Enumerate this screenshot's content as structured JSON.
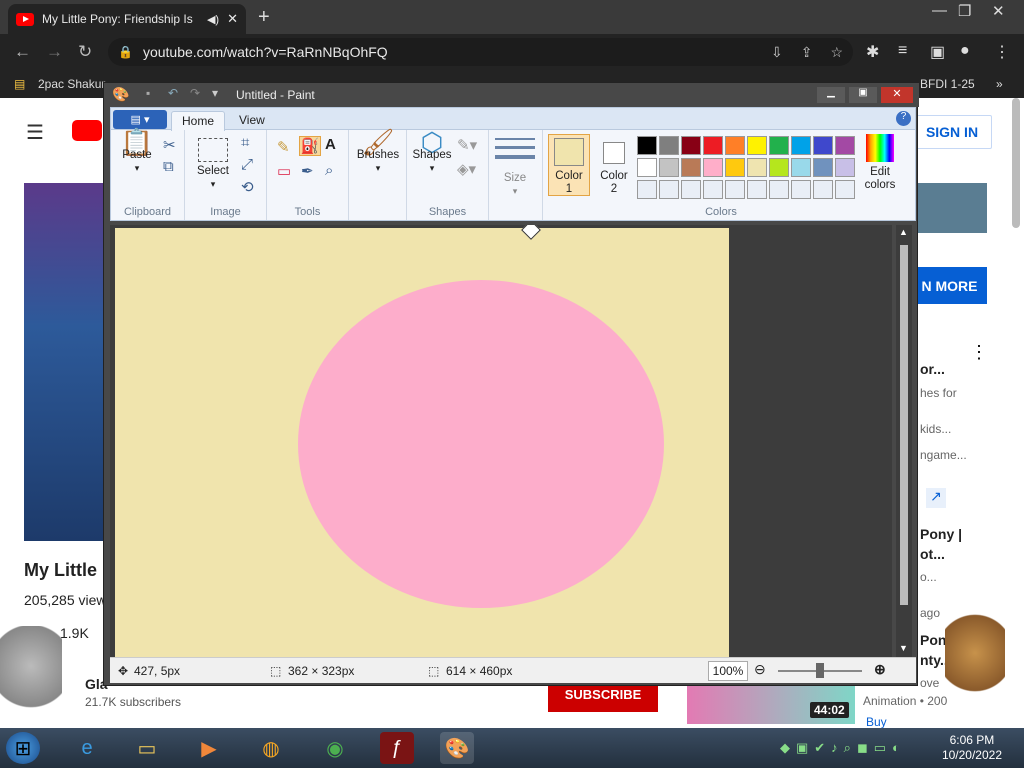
{
  "browser": {
    "tab_title": "My Little Pony: Friendship Is",
    "url": "youtube.com/watch?v=RaRnNBqOhFQ",
    "bookmarks": [
      "2pac Shakur",
      "BFDI 1-25"
    ]
  },
  "youtube": {
    "sign_in": "SIGN IN",
    "learn_more": "N MORE",
    "video_title": "My Little",
    "views": "205,285 view",
    "likes": "1.9K",
    "channel_initial": "Gla",
    "subscribers": "21.7K subscribers",
    "subscribe": "SUBSCRIBE",
    "duration": "44:02",
    "side_texts": [
      "or...",
      "hes for",
      "kids...",
      "ngame...",
      "Pony |",
      "ot...",
      "o...",
      "ago",
      "Pony",
      "nty..",
      "ove",
      "Animation • 200",
      "Buy"
    ]
  },
  "paint": {
    "title": "Untitled - Paint",
    "tabs": [
      "Home",
      "View"
    ],
    "groups": {
      "clipboard": {
        "label": "Clipboard",
        "paste": "Paste"
      },
      "image": {
        "label": "Image",
        "select": "Select"
      },
      "tools": {
        "label": "Tools"
      },
      "brushes": "Brushes",
      "shapes": {
        "label": "Shapes",
        "shapes_btn": "Shapes"
      },
      "size": "Size",
      "colors": {
        "label": "Colors",
        "color1": "Color 1",
        "color2": "Color 2",
        "edit": "Edit colors"
      }
    },
    "color1_value": "#f0e4ad",
    "color2_value": "#ffffff",
    "palette_row1": [
      "#000000",
      "#7f7f7f",
      "#880015",
      "#ed1c24",
      "#ff7f27",
      "#fff200",
      "#22b14c",
      "#00a2e8",
      "#3f48cc",
      "#a349a4"
    ],
    "palette_row2": [
      "#ffffff",
      "#c3c3c3",
      "#b97a57",
      "#ffaec9",
      "#ffc90e",
      "#efe4b0",
      "#b5e61d",
      "#99d9ea",
      "#7092be",
      "#c8bfe7"
    ],
    "canvas_color": "#f0e4ad",
    "ellipse_color": "#fdadcb",
    "status": {
      "cursor": "427, 5px",
      "selection": "362 × 323px",
      "size": "614 × 460px",
      "zoom": "100%"
    }
  },
  "taskbar": {
    "time": "6:06 PM",
    "date": "10/20/2022"
  }
}
